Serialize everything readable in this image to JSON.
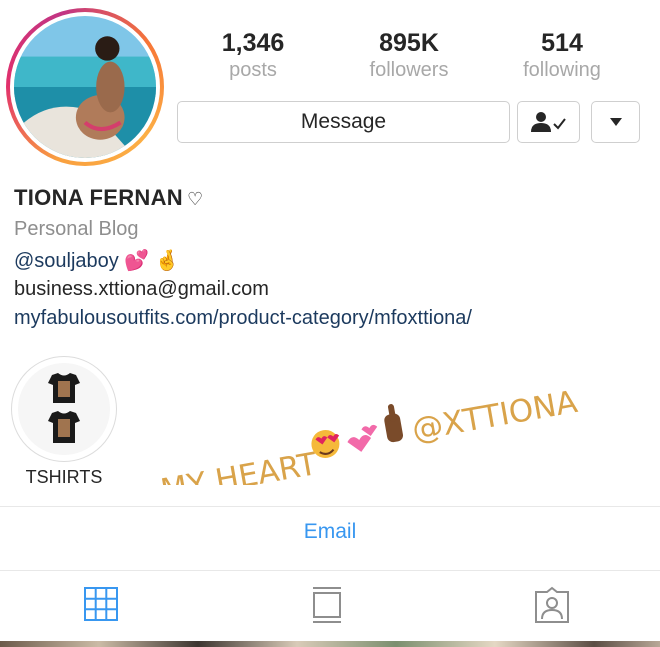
{
  "profile": {
    "stats": {
      "posts": {
        "count": "1,346",
        "label": "posts"
      },
      "followers": {
        "count": "895K",
        "label": "followers"
      },
      "following": {
        "count": "514",
        "label": "following"
      }
    },
    "message_label": "Message",
    "name": "TIONA FERNAN",
    "name_symbol": "♡",
    "category": "Personal Blog",
    "handle": "@souljaboy",
    "handle_emojis": "💕 🤞",
    "email": "business.xttiona@gmail.com",
    "website": "myfabulousoutfits.com/product-category/mfoxttiona/"
  },
  "highlight": {
    "label": "TSHIRTS"
  },
  "story_overlay": {
    "text_left": "MY HEART",
    "text_right": "@XTTIONA",
    "color": "#d9a34a"
  },
  "contact": {
    "email_label": "Email"
  },
  "tabs": [
    "grid-icon",
    "feed-icon",
    "tagged-icon"
  ],
  "colors": {
    "link": "#1c3a5e",
    "accent": "#3897f0",
    "active_tab": "#3897f0",
    "muted": "#a8a8a8"
  }
}
